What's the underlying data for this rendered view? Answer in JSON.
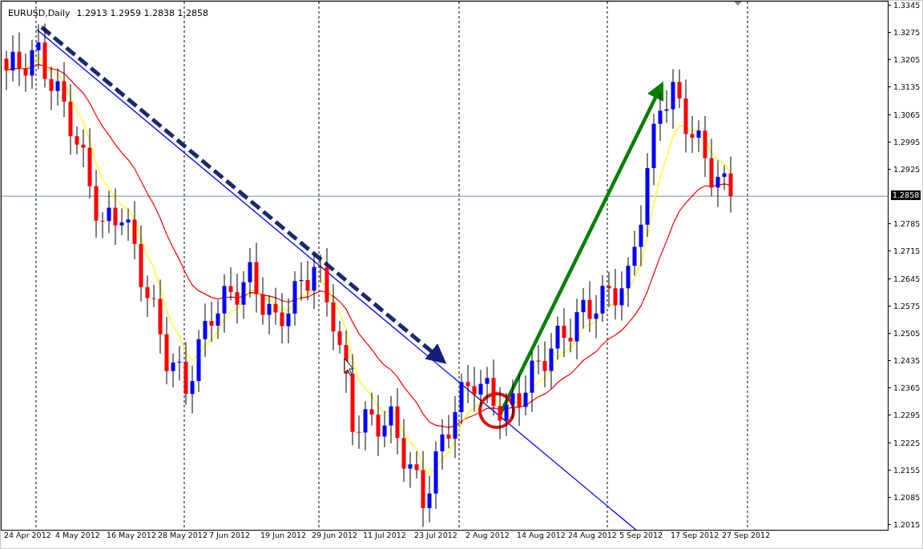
{
  "chart": {
    "symbol": "EURUSD,Daily",
    "quote": "1.2913 1.2959 1.2838 1.2858"
  },
  "price_axis": {
    "labels": [
      "1.3345",
      "1.3275",
      "1.3205",
      "1.3135",
      "1.3065",
      "1.2995",
      "1.2925",
      "1.2785",
      "1.2715",
      "1.2645",
      "1.2575",
      "1.2505",
      "1.2435",
      "1.2365",
      "1.2295",
      "1.2225",
      "1.2155",
      "1.2085",
      "1.2015"
    ],
    "current_price": "1.2858"
  },
  "date_axis": {
    "labels": [
      "24 Apr 2012",
      "4 May 2012",
      "16 May 2012",
      "28 May 2012",
      "7 Jun 2012",
      "19 Jun 2012",
      "29 Jun 2012",
      "11 Jul 2012",
      "23 Jul 2012",
      "2 Aug 2012",
      "14 Aug 2012",
      "24 Aug 2012",
      "5 Sep 2012",
      "17 Sep 2012",
      "27 Sep 2012"
    ]
  }
}
